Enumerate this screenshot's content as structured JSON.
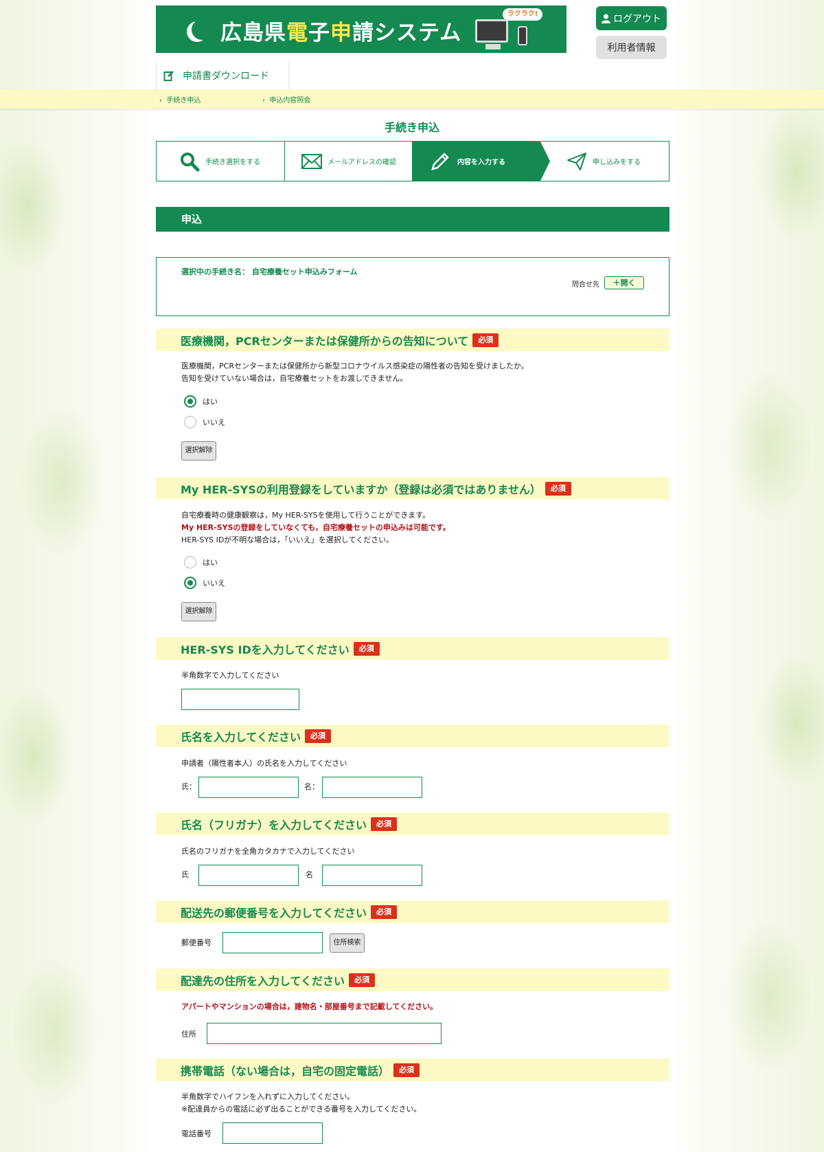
{
  "header": {
    "banner_title_part1": "広島県",
    "banner_title_part2": "電",
    "banner_title_part3": "子",
    "banner_title_part4": "申",
    "banner_title_part5": "請システム",
    "banner_bubble": "ラクラク!",
    "logout_label": "ログアウト",
    "userinfo_label": "利用者情報",
    "download_tab_label": "申請書ダウンロード"
  },
  "breadcrumb": [
    "手続き申込",
    "申込内容照会"
  ],
  "page_title": "手続き申込",
  "steps": [
    {
      "label": "手続き選択をする",
      "icon": "search-icon"
    },
    {
      "label": "メールアドレスの確認",
      "icon": "mail-icon"
    },
    {
      "label": "内容を入力する",
      "icon": "pencil-icon",
      "active": true
    },
    {
      "label": "申し込みをする",
      "icon": "send-icon"
    }
  ],
  "section_title": "申込",
  "procedure": {
    "name_label": "選択中の手続き名：",
    "name_value": "自宅療養セット申込みフォーム",
    "inquiry_label": "問合せ先",
    "open_label": "＋開く"
  },
  "required_badge": "必須",
  "q1": {
    "title": "医療機関，PCRセンターまたは保健所からの告知について",
    "desc1": "医療機関，PCRセンターまたは保健所から新型コロナウイルス感染症の陽性者の告知を受けましたか。",
    "desc2": "告知を受けていない場合は，自宅療養セットをお渡しできません。",
    "option_yes": "はい",
    "option_no": "いいえ",
    "selected": "はい",
    "clear_label": "選択解除"
  },
  "q2": {
    "title": "My HER-SYSの利用登録をしていますか（登録は必須ではありません）",
    "desc1": "自宅療養時の健康観察は，My HER-SYSを使用して行うことができます。",
    "desc2": "My HER-SYSの登録をしていなくても，自宅療養セットの申込みは可能です。",
    "desc3": "HER-SYS IDが不明な場合は，「いいえ」を選択してください。",
    "option_yes": "はい",
    "option_no": "いいえ",
    "selected": "いいえ",
    "clear_label": "選択解除"
  },
  "q3": {
    "title": "HER-SYS IDを入力してください",
    "desc": "半角数字で入力してください",
    "value": ""
  },
  "q4": {
    "title": "氏名を入力してください",
    "desc": "申請者（陽性者本人）の氏名を入力してください",
    "last_label": "氏：",
    "first_label": "名：",
    "last_value": "",
    "first_value": ""
  },
  "q5": {
    "title": "氏名（フリガナ）を入力してください",
    "desc": "氏名のフリガナを全角カタカナで入力してください",
    "last_label": "氏",
    "first_label": "名",
    "last_value": "",
    "first_value": ""
  },
  "q6": {
    "title": "配送先の郵便番号を入力してください",
    "postal_label": "郵便番号",
    "postal_value": "",
    "search_label": "住所検索"
  },
  "q7": {
    "title": "配達先の住所を入力してください",
    "desc": "アパートやマンションの場合は，建物名・部屋番号まで記載してください。",
    "address_label": "住所",
    "address_value": ""
  },
  "q8": {
    "title": "携帯電話（ない場合は，自宅の固定電話）",
    "desc1": "半角数字でハイフンを入れずに入力してください。",
    "desc2": "※配達員からの電話に必ず出ることができる番号を入力してください。",
    "phone_label": "電話番号",
    "phone_value": ""
  },
  "colors": {
    "brand_green": "#148a50",
    "highlight_yellow": "#fdf9c4",
    "required_red": "#d9311b",
    "warning_red": "#b3141a"
  }
}
